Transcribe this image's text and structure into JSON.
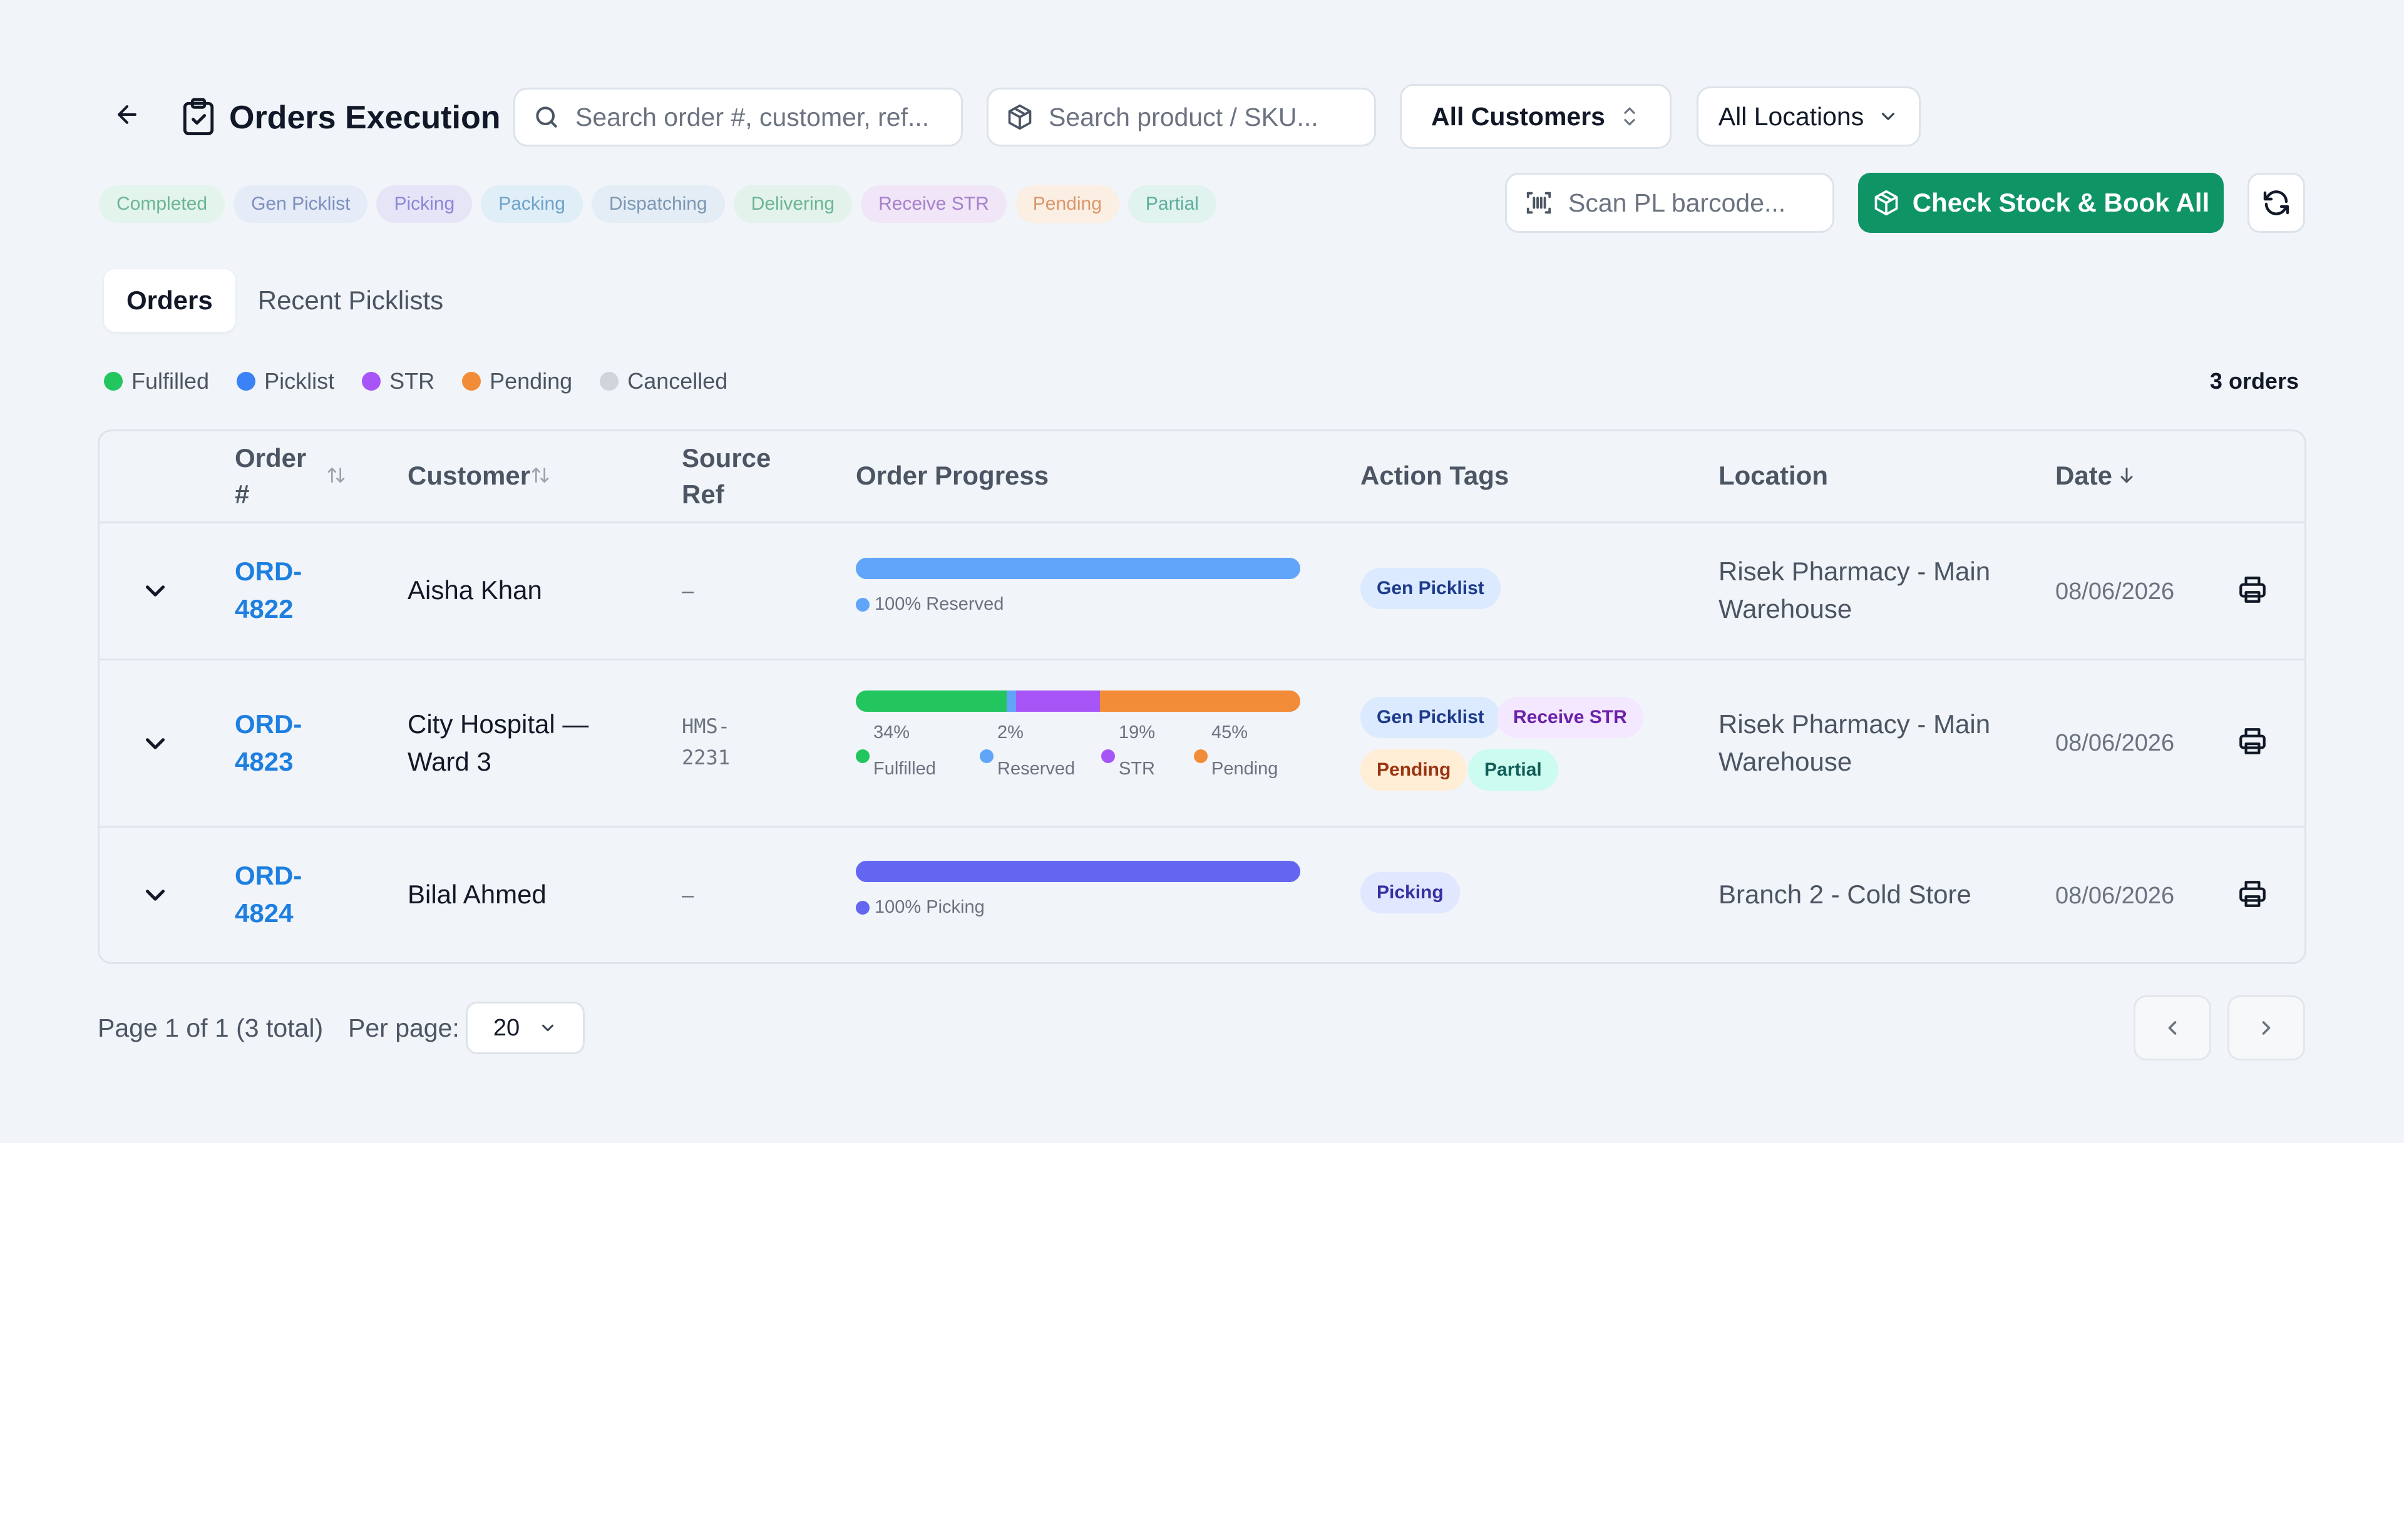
{
  "header": {
    "title": "Orders Execution",
    "search_order_placeholder": "Search order #, customer, ref...",
    "search_product_placeholder": "Search product / SKU...",
    "customers_select": "All Customers",
    "locations_select": "All Locations"
  },
  "status_chips": [
    {
      "label": "Completed",
      "bg": "#e3f4ec",
      "fg": "#6bb594"
    },
    {
      "label": "Gen Picklist",
      "bg": "#e5ebf7",
      "fg": "#7d8fbf"
    },
    {
      "label": "Picking",
      "bg": "#e6e5f8",
      "fg": "#8a87d6"
    },
    {
      "label": "Packing",
      "bg": "#e0eef7",
      "fg": "#6fa3c9"
    },
    {
      "label": "Dispatching",
      "bg": "#e4edf5",
      "fg": "#7c97b4"
    },
    {
      "label": "Delivering",
      "bg": "#e3f3ec",
      "fg": "#6cb593"
    },
    {
      "label": "Receive STR",
      "bg": "#f0e6f7",
      "fg": "#a77fcc"
    },
    {
      "label": "Pending",
      "bg": "#fbeee2",
      "fg": "#d8976a"
    },
    {
      "label": "Partial",
      "bg": "#e0f3ef",
      "fg": "#5fae9b"
    }
  ],
  "actions": {
    "scan_placeholder": "Scan PL barcode...",
    "check_stock_label": "Check Stock & Book All"
  },
  "tabs": [
    "Orders",
    "Recent Picklists"
  ],
  "legend": [
    {
      "label": "Fulfilled",
      "color": "#22c55e"
    },
    {
      "label": "Picklist",
      "color": "#3b82f6"
    },
    {
      "label": "STR",
      "color": "#a855f7"
    },
    {
      "label": "Pending",
      "color": "#f28c38"
    },
    {
      "label": "Cancelled",
      "color": "#d1d5db"
    }
  ],
  "order_count": "3 orders",
  "table": {
    "headers": {
      "order": "Order #",
      "customer": "Customer",
      "source": "Source Ref",
      "progress": "Order Progress",
      "tags": "Action Tags",
      "location": "Location",
      "date": "Date"
    },
    "rows": [
      {
        "order_id": "ORD-4822",
        "customer": "Aisha Khan",
        "source": "–",
        "progress_caption": "100% Reserved",
        "tags": [
          "Gen Picklist"
        ],
        "location": "Risek Pharmacy - Main Warehouse",
        "date": "08/06/2026"
      },
      {
        "order_id": "ORD-4823",
        "customer": "City Hospital — Ward 3",
        "source": "HMS-2231",
        "segments": [
          {
            "pct": "34%",
            "label": "Fulfilled",
            "value": 34
          },
          {
            "pct": "2%",
            "label": "Reserved",
            "value": 2
          },
          {
            "pct": "19%",
            "label": "STR",
            "value": 19
          },
          {
            "pct": "45%",
            "label": "Pending",
            "value": 45
          }
        ],
        "tags": [
          "Gen Picklist",
          "Receive STR",
          "Pending",
          "Partial"
        ],
        "location": "Risek Pharmacy - Main Warehouse",
        "date": "08/06/2026"
      },
      {
        "order_id": "ORD-4824",
        "customer": "Bilal Ahmed",
        "source": "–",
        "progress_caption": "100% Picking",
        "tags": [
          "Picking"
        ],
        "location": "Branch 2 - Cold Store",
        "date": "08/06/2026"
      }
    ]
  },
  "pagination": {
    "summary": "Page 1 of 1 (3 total)",
    "per_page_label": "Per page:",
    "per_page_value": "20"
  }
}
